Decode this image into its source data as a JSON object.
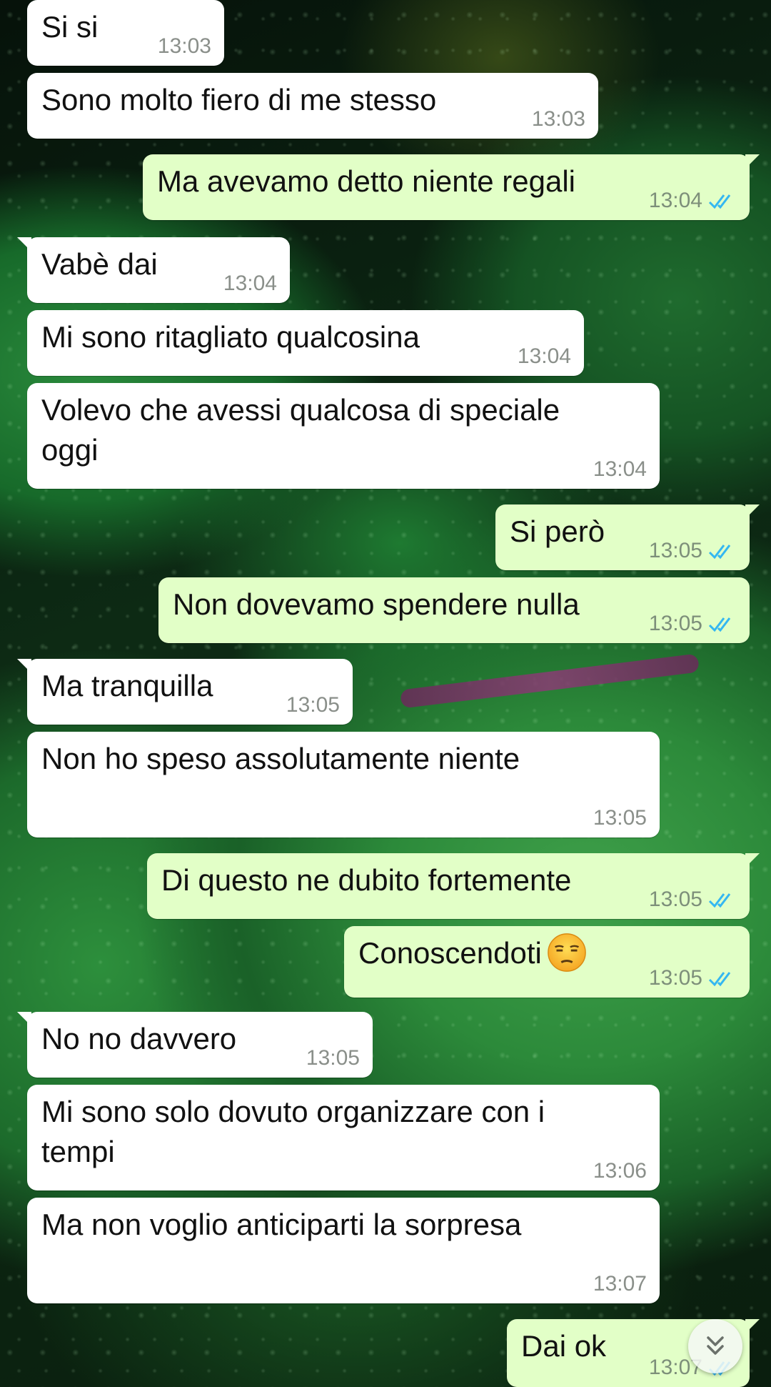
{
  "messages": [
    {
      "direction": "in",
      "text": "Si si",
      "time": "13:03"
    },
    {
      "direction": "in",
      "text": "Sono molto fiero di me stesso",
      "time": "13:03"
    },
    {
      "direction": "out",
      "text": "Ma avevamo detto niente regali",
      "time": "13:04",
      "status": "read"
    },
    {
      "direction": "in",
      "text": "Vabè dai",
      "time": "13:04"
    },
    {
      "direction": "in",
      "text": "Mi sono ritagliato qualcosina",
      "time": "13:04"
    },
    {
      "direction": "in",
      "text": "Volevo che avessi qualcosa di speciale oggi",
      "time": "13:04"
    },
    {
      "direction": "out",
      "text": "Si però",
      "time": "13:05",
      "status": "read"
    },
    {
      "direction": "out",
      "text": "Non dovevamo spendere nulla",
      "time": "13:05",
      "status": "read"
    },
    {
      "direction": "in",
      "text": "Ma tranquilla",
      "time": "13:05"
    },
    {
      "direction": "in",
      "text": "Non ho speso assolutamente niente",
      "time": "13:05"
    },
    {
      "direction": "out",
      "text": "Di questo ne dubito fortemente",
      "time": "13:05",
      "status": "read"
    },
    {
      "direction": "out",
      "text": "Conoscendoti",
      "emoji": "unamused-face",
      "time": "13:05",
      "status": "read"
    },
    {
      "direction": "in",
      "text": "No no davvero",
      "time": "13:05"
    },
    {
      "direction": "in",
      "text": "Mi sono solo dovuto organizzare con i tempi",
      "time": "13:06"
    },
    {
      "direction": "in",
      "text": "Ma non voglio anticiparti la sorpresa",
      "time": "13:07"
    },
    {
      "direction": "out",
      "text": "Dai ok",
      "time": "13:07",
      "status": "read"
    }
  ],
  "icons": {
    "read_ticks": "double-check-icon",
    "scroll_down": "double-chevron-down-icon"
  },
  "colors": {
    "incoming_bubble": "#ffffff",
    "outgoing_bubble": "#e2ffc7",
    "read_ticks": "#34b7f1"
  }
}
